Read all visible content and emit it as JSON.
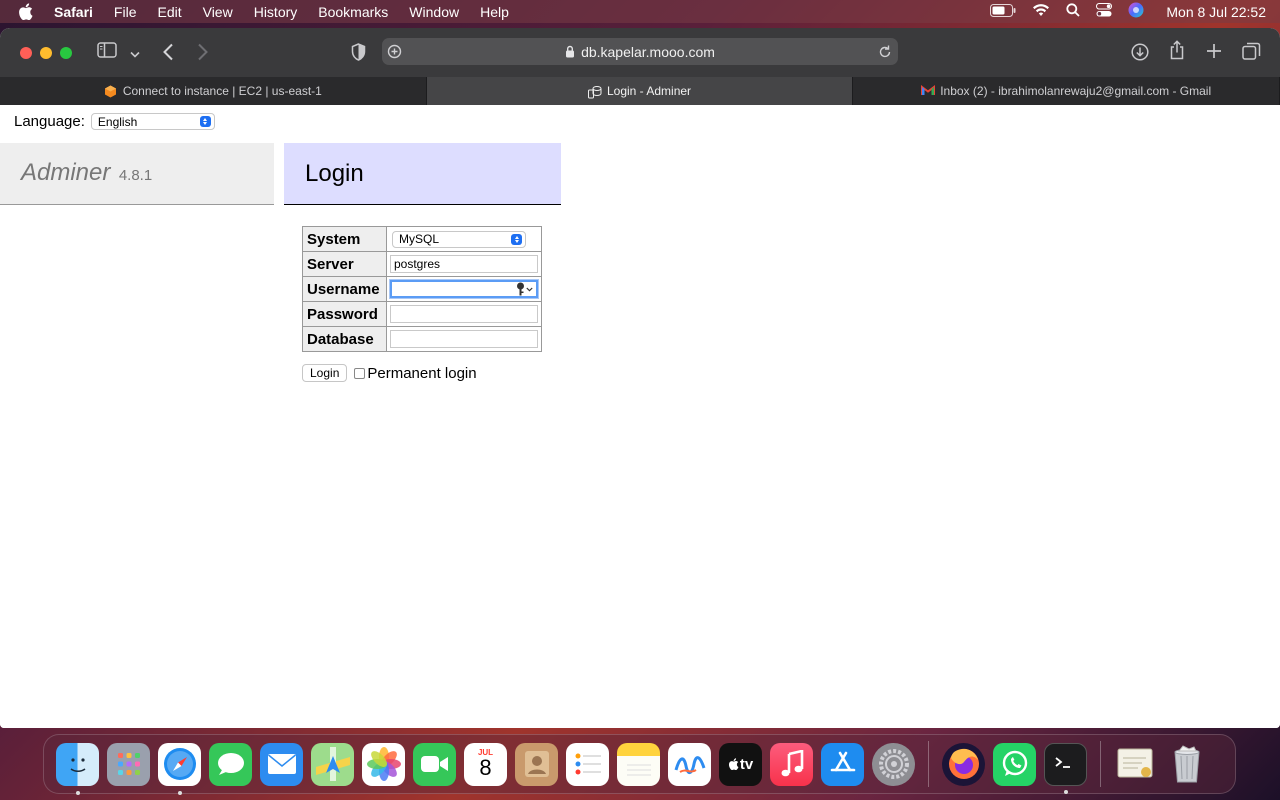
{
  "menubar": {
    "app_name": "Safari",
    "items": [
      "File",
      "Edit",
      "View",
      "History",
      "Bookmarks",
      "Window",
      "Help"
    ],
    "clock": "Mon 8 Jul  22:52"
  },
  "browser": {
    "url": "db.kapelar.mooo.com",
    "tabs": [
      {
        "label": "Connect to instance | EC2 | us-east-1",
        "icon": "aws-icon"
      },
      {
        "label": "Login - Adminer",
        "icon": "adminer-icon"
      },
      {
        "label": "Inbox (2) - ibrahimolanrewaju2@gmail.com - Gmail",
        "icon": "gmail-icon"
      }
    ]
  },
  "page": {
    "language_label": "Language:",
    "language_value": "English",
    "brand_name": "Adminer",
    "brand_version": "4.8.1",
    "heading": "Login",
    "form": {
      "system_label": "System",
      "system_value": "MySQL",
      "server_label": "Server",
      "server_value": "postgres",
      "username_label": "Username",
      "username_value": "",
      "password_label": "Password",
      "password_value": "",
      "database_label": "Database",
      "database_value": "",
      "login_button": "Login",
      "permanent_label": "Permanent login"
    }
  },
  "dock": {
    "calendar_month": "JUL",
    "calendar_day": "8",
    "tv_label": "tv"
  }
}
